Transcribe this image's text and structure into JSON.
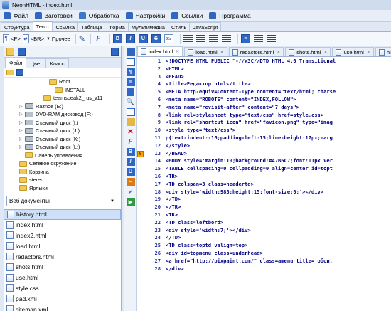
{
  "window": {
    "title": "NeonHTML - index.html"
  },
  "menu": [
    {
      "label": "Файл",
      "icon": "file-menu-icon",
      "color": "#2f67c2"
    },
    {
      "label": "Заготовки",
      "icon": "templates-icon",
      "color": "#2f67c2"
    },
    {
      "label": "Обработка",
      "icon": "process-icon",
      "color": "#3a78c8"
    },
    {
      "label": "Настройки",
      "icon": "settings-icon",
      "color": "#2f67c2"
    },
    {
      "label": "Ссылки",
      "icon": "links-icon",
      "color": "#2f67c2"
    },
    {
      "label": "Программа",
      "icon": "program-icon",
      "color": "#2f67c2"
    }
  ],
  "ribbon_tabs": [
    "Структура",
    "Текст",
    "Ссылка",
    "Таблица",
    "Форма",
    "Мультимедиа",
    "Стиль",
    "JavaScript"
  ],
  "ribbon_active": 1,
  "toolbar": {
    "p_tag": "<P>",
    "br_tag": "<BR>",
    "other_label": "Прочее",
    "icon_f": "F",
    "icon_b": "B",
    "icon_i": "I",
    "icon_u": "U",
    "icon_s": "S"
  },
  "left_panel": {
    "tabs": [
      "Файл",
      "Цвет",
      "Класс"
    ],
    "tree": [
      {
        "label": "Root",
        "indent": 56,
        "type": "folder"
      },
      {
        "label": "INSTALL",
        "indent": 64,
        "type": "folder"
      },
      {
        "label": "teamspeak2_rus_v11",
        "indent": 48,
        "type": "folder"
      },
      {
        "label": "Raznoe (E:)",
        "indent": 22,
        "type": "drive"
      },
      {
        "label": "DVD-RAM дисковод (F:)",
        "indent": 22,
        "type": "drive"
      },
      {
        "label": "Съемный диск (I:)",
        "indent": 22,
        "type": "drive"
      },
      {
        "label": "Съемный диск (J:)",
        "indent": 22,
        "type": "drive"
      },
      {
        "label": "Съемный диск (K:)",
        "indent": 22,
        "type": "drive"
      },
      {
        "label": "Съемный диск (L:)",
        "indent": 22,
        "type": "drive"
      },
      {
        "label": "Панель управления",
        "indent": 22,
        "type": "folder"
      },
      {
        "label": "Сетевое окружение",
        "indent": 14,
        "type": "folder"
      },
      {
        "label": "Корзина",
        "indent": 14,
        "type": "folder"
      },
      {
        "label": "stereo",
        "indent": 14,
        "type": "folder"
      },
      {
        "label": "Ярлыки",
        "indent": 14,
        "type": "folder"
      }
    ],
    "filter_combo": "Веб документы",
    "files": [
      "history.html",
      "index.html",
      "index2.html",
      "load.html",
      "redactors.html",
      "shots.html",
      "use.html",
      "style.css",
      "pad.xml",
      "sitemap.xml"
    ],
    "selected_file": 0
  },
  "doc_tabs": [
    "index.html",
    "load.html",
    "redactors.html",
    "shots.html",
    "use.html",
    "history.html"
  ],
  "active_doc": 0,
  "code_lines": [
    "<!DOCTYPE HTML PUBLIC \"-//W3C//DTD HTML 4.0 Transitional",
    "<HTML>",
    "<HEAD>",
    "<title>Редактор html</title>",
    "<META http-equiv=Content-Type content=\"text/html; charse",
    "<meta name=\"ROBOTS\" content=\"INDEX,FOLLOW\">",
    "<meta name=\"revisit-after\" content=\"7 days\">",
    "<link rel=stylesheet type=\"text/css\" href=style.css>",
    "<link rel=\"shortcut icon\" href=\"favicon.png\" type=\"imag",
    "<style type=\"text/css\">",
    "p{text-indent:-16;padding-left:15;line-height:17px;marg",
    "</style>",
    "</HEAD>",
    "<BODY style='margin:10;background:#A7B6C7;font:11px Ver",
    "<TABLE cellspacing=0 cellpadding=0 align=center id=topt",
    "<TR>",
    "<TD colspan=3 class=headertd>",
    "<div style='width:983;height:15;font-size:0;'></div>",
    "</TD>",
    "</TR>",
    "<TR>",
    "<TD class=leftbord>",
    "<div style='width:7;'></div>",
    "</TD>",
    "<TD class=toptd valign=top>",
    "<div id=topmenu class=underhead>",
    "<a href=\"http://pixpaint.com/\" class=amenu title='обои,",
    "</div>"
  ],
  "line_start": 1,
  "bookmark_label": "0",
  "bookmark_line": 13
}
